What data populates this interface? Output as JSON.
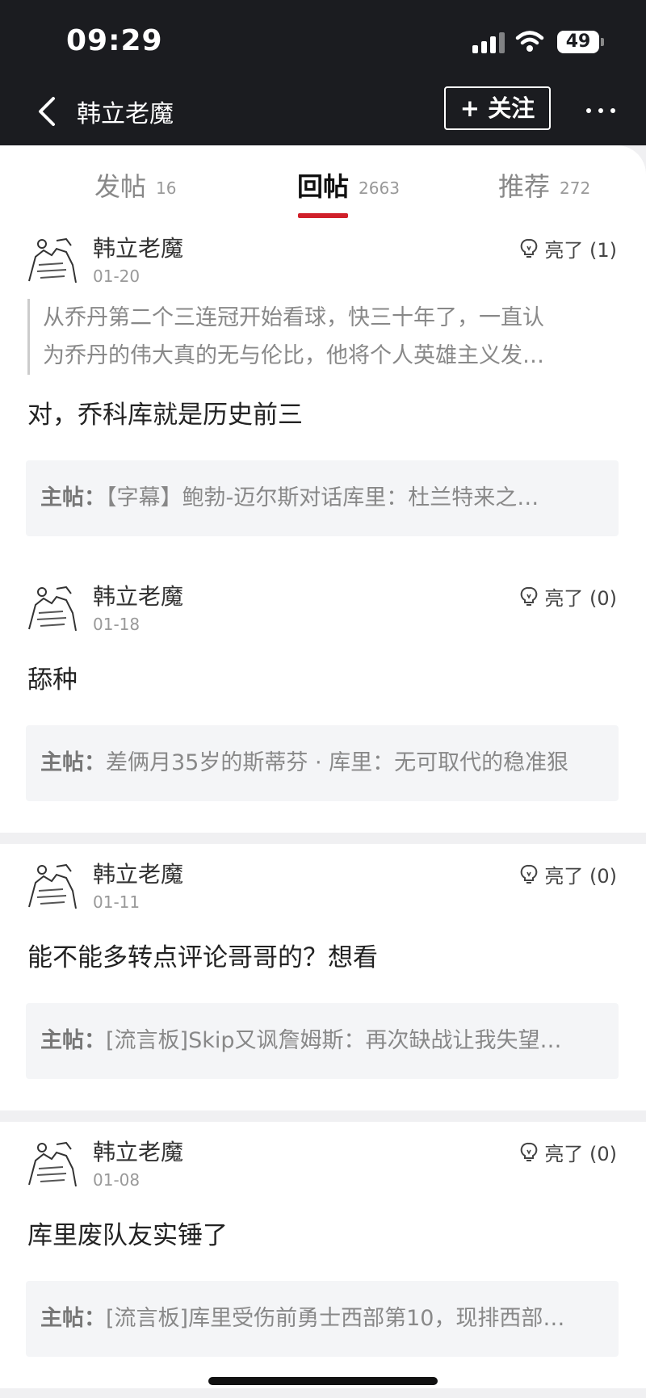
{
  "status_bar": {
    "time": "09:29",
    "battery": "49"
  },
  "header": {
    "title": "韩立老魔",
    "follow_label": "+ 关注"
  },
  "tabs": [
    {
      "label": "发帖",
      "count": "16"
    },
    {
      "label": "回帖",
      "count": "2663"
    },
    {
      "label": "推荐",
      "count": "272"
    }
  ],
  "colors": {
    "accent": "#d0202a",
    "topbar": "#1b1c20"
  },
  "posts": [
    {
      "author": "韩立老魔",
      "date": "01-20",
      "light": "亮了 (1)",
      "quote_line1": "从乔丹第二个三连冠开始看球，快三十年了，一直认",
      "quote_line2": "为乔丹的伟大真的无与伦比，他将个人英雄主义发…",
      "reply": "对，乔科库就是历史前三",
      "thread_label": "主帖：",
      "thread_title": "【字幕】鲍勃-迈尔斯对话库里：杜兰特来之…"
    },
    {
      "author": "韩立老魔",
      "date": "01-18",
      "light": "亮了 (0)",
      "reply": "舔种",
      "thread_label": "主帖：",
      "thread_title": "差俩月35岁的斯蒂芬 · 库里：无可取代的稳准狠"
    },
    {
      "author": "韩立老魔",
      "date": "01-11",
      "light": "亮了 (0)",
      "reply": "能不能多转点评论哥哥的？想看",
      "thread_label": "主帖：",
      "thread_title": "[流言板]Skip又讽詹姆斯：再次缺战让我失望…"
    },
    {
      "author": "韩立老魔",
      "date": "01-08",
      "light": "亮了 (0)",
      "reply": "库里废队友实锤了",
      "thread_label": "主帖：",
      "thread_title": "[流言板]库里受伤前勇士西部第10，现排西部…"
    }
  ]
}
